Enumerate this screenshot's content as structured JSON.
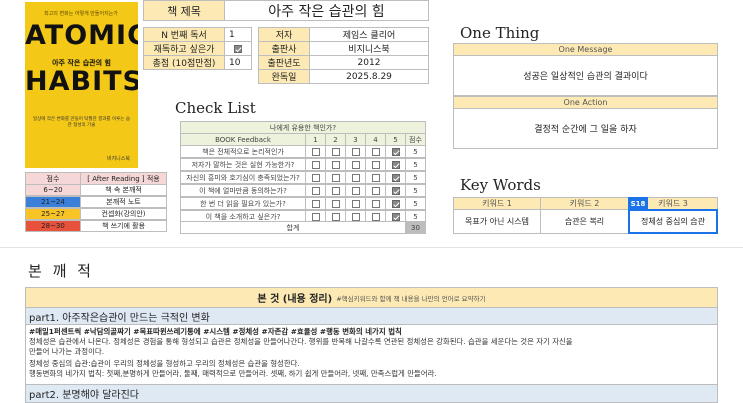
{
  "cover": {
    "tagline": "최고의 변화는 어떻게 만들어지는가",
    "title_line1": "ATOMIC",
    "subtitle": "아주 작은 습관의 힘",
    "title_line2": "HABITS",
    "blurb": "일상에 작은 변화를 만들어 탁월한 결과를 이루는 습관 형성의 기술",
    "publisher": "비지니스북"
  },
  "title_row": {
    "label": "책 제목",
    "value": "아주 작은 습관의 힘"
  },
  "info_left": [
    {
      "label": "N 번째 독서",
      "value": "1"
    },
    {
      "label": "재독하고 싶은가",
      "value": "checked"
    },
    {
      "label": "총점 (10점만점)",
      "value": "10"
    }
  ],
  "info_right": [
    {
      "label": "저자",
      "value": "제임스 클리어"
    },
    {
      "label": "출판사",
      "value": "비지니스북"
    },
    {
      "label": "출판년도",
      "value": "2012"
    },
    {
      "label": "완독일",
      "value": "2025.8.29"
    }
  ],
  "checklist": {
    "title": "Check List",
    "question": "나에게 유용한 책인가?",
    "col_feedback": "BOOK Feedback",
    "cols": [
      "1",
      "2",
      "3",
      "4",
      "5",
      "점수"
    ],
    "rows": [
      {
        "q": "책은 전체적으로 논리적인가",
        "score": "5"
      },
      {
        "q": "저자가 말하는 것은 실현 가능한가?",
        "score": "5"
      },
      {
        "q": "자신의 흥미와 호기심이 충족되었는가?",
        "score": "5"
      },
      {
        "q": "이 책에 얼마만큼 동의하는가?",
        "score": "5"
      },
      {
        "q": "한 번 더 읽을 필요가 있는가?",
        "score": "5"
      },
      {
        "q": "이 책을 소개하고 싶은가?",
        "score": "5"
      }
    ],
    "total_label": "합계",
    "total": "30"
  },
  "legend": {
    "head_score": "점수",
    "head_apply": "[ After Reading ] 적용",
    "rows": [
      {
        "score": "6~20",
        "text": "책 속 본깨적",
        "color": "#f6d7d7"
      },
      {
        "score": "21~24",
        "text": "본깨적 노트",
        "color": "#3c7fd8"
      },
      {
        "score": "25~27",
        "text": "컨셉화(강의안)",
        "color": "#f8c325"
      },
      {
        "score": "28~30",
        "text": "책 쓰기에 활용",
        "color": "#e8513c"
      }
    ]
  },
  "one_thing": {
    "title": "One Thing",
    "message_label": "One Message",
    "message": "성공은 일상적인 습관의 결과이다",
    "action_label": "One Action",
    "action": "결정적 순간에 그 일을 하자"
  },
  "keywords": {
    "title": "Key Words",
    "items": [
      {
        "label": "키워드 1",
        "value": "목표가 아닌 시스템"
      },
      {
        "label": "키워드 2",
        "value": "습관은 복리"
      },
      {
        "label": "키워드 3",
        "value": "정체성 중심의 습관"
      }
    ],
    "badge": "S18"
  },
  "bonkkae": {
    "section_title": "본 깨 적",
    "main_head": "본 것 (내용 정리)",
    "main_hint": "#핵심키워드와 함께 책 내용을 나만의 언어로 요약하기",
    "part1_title": "part1. 아주작은습관이 만드는 극적인 변화",
    "part1_tags": "#매일1퍼센트씩 #낙담의골짜기 #목표따윈쓰레기통에 #시스템 #정체성 #자존감 #효율성 #행동 변화의 네가지 법칙",
    "part1_lines": [
      "정체성은 습관에서 나온다. 정체성은 경험을 통해 형성되고 습관은 정체성을 만들어나간다. 행위를 반복해 나갈수록 연관된 정체성은 강화된다. 습관을 세운다는 것은 자기 자신을",
      "만들어 나가는 과정이다.",
      "정체성 중심의 습관:습관이 우리의 정체성을 형성하고 우리의 정체성은 습관을 형성한다.",
      "행동변화의 네가지 법칙: 첫째,분명하게 만들어라, 둘째, 매력적으로 만들어라. 셋째, 하기 쉽게 만들어라, 넷째, 만족스럽게 만들어라."
    ],
    "part2_title": "part2. 분명해야 달라진다"
  }
}
